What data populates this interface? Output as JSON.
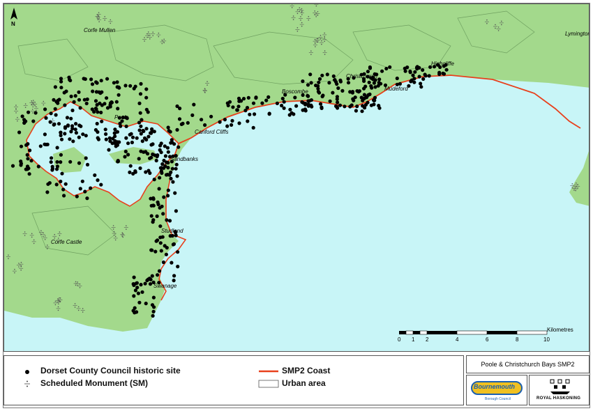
{
  "map": {
    "north_label": "N",
    "places": [
      {
        "name": "Corfe Mullen",
        "id": "corfe-mullen"
      },
      {
        "name": "Lymington",
        "id": "lymington"
      },
      {
        "name": "Highcliffe",
        "id": "highcliffe"
      },
      {
        "name": "Christchurch",
        "id": "christchurch"
      },
      {
        "name": "Mudeford",
        "id": "mudeford"
      },
      {
        "name": "Boscombe",
        "id": "boscombe"
      },
      {
        "name": "Poole",
        "id": "poole"
      },
      {
        "name": "Canford Cliffs",
        "id": "canford-cliffs"
      },
      {
        "name": "Sandbanks",
        "id": "sandbanks"
      },
      {
        "name": "Studland",
        "id": "studland"
      },
      {
        "name": "Corfe Castle",
        "id": "corfe-castle"
      },
      {
        "name": "Swanage",
        "id": "swanage"
      }
    ],
    "colors": {
      "land": "#a3d98c",
      "sea": "#c8f5f7",
      "coast": "#e8401c",
      "site": "#000000"
    }
  },
  "scale": {
    "unit": "Kilometres",
    "ticks": [
      "0",
      "1",
      "2",
      "4",
      "6",
      "8",
      "10"
    ]
  },
  "legend": {
    "historic_site": "Dorset County Council historic site",
    "scheduled_monument": "Scheduled Monument (SM)",
    "smp2_coast": "SMP2 Coast",
    "urban_area": "Urban area"
  },
  "title": "Poole & Christchurch Bays SMP2",
  "logos": {
    "bournemouth": "Bournemouth",
    "bournemouth_sub": "Borough Council",
    "royal_haskoning": "ROYAL HASKONING"
  }
}
